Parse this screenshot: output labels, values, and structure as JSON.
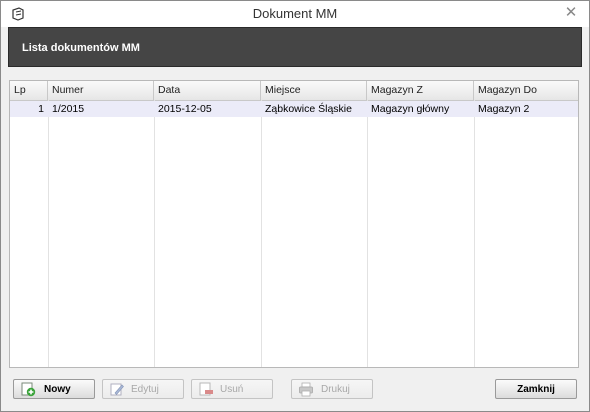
{
  "window": {
    "title": "Dokument MM",
    "close_glyph": "✕"
  },
  "header": {
    "title": "Lista dokumentów MM"
  },
  "table": {
    "columns": [
      "Lp",
      "Numer",
      "Data",
      "Miejsce",
      "Magazyn Z",
      "Magazyn Do"
    ],
    "rows": [
      {
        "lp": "1",
        "numer": "1/2015",
        "data": "2015-12-05",
        "miejsce": "Ząbkowice Śląskie",
        "magazyn_z": "Magazyn główny",
        "magazyn_do": "Magazyn 2"
      }
    ]
  },
  "buttons": {
    "nowy": "Nowy",
    "edytuj": "Edytuj",
    "usun": "Usuń",
    "drukuj": "Drukuj",
    "zamknij": "Zamknij"
  },
  "colors": {
    "header_band": "#454545",
    "row_selected": "#ebebf8"
  }
}
